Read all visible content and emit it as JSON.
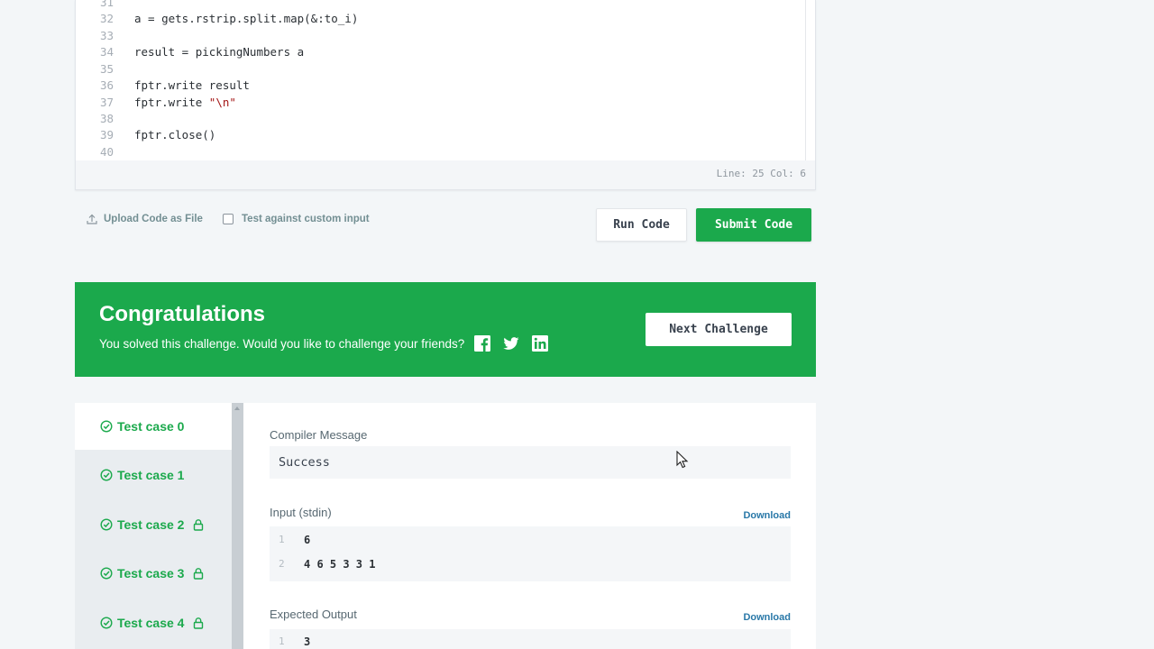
{
  "editor": {
    "lines": [
      {
        "num": "31",
        "text": ""
      },
      {
        "num": "32",
        "text": "a = gets.rstrip.split.map(&:to_i)"
      },
      {
        "num": "33",
        "text": ""
      },
      {
        "num": "34",
        "text": "result = pickingNumbers a"
      },
      {
        "num": "35",
        "text": ""
      },
      {
        "num": "36",
        "text": "fptr.write result"
      },
      {
        "num": "37",
        "text": "fptr.write ",
        "str": "\"\\n\""
      },
      {
        "num": "38",
        "text": ""
      },
      {
        "num": "39",
        "text": "fptr.close()"
      },
      {
        "num": "40",
        "text": ""
      }
    ],
    "status": "Line: 25 Col: 6"
  },
  "actions": {
    "upload_label": "Upload Code as File",
    "custom_input_label": "Test against custom input",
    "run_label": "Run Code",
    "submit_label": "Submit Code"
  },
  "congrats": {
    "title": "Congratulations",
    "message": "You solved this challenge. Would you like to challenge your friends?",
    "next_label": "Next Challenge"
  },
  "tabs": [
    {
      "label": "Test case 0",
      "locked": false,
      "active": true
    },
    {
      "label": "Test case 1",
      "locked": false,
      "active": false
    },
    {
      "label": "Test case 2",
      "locked": true,
      "active": false
    },
    {
      "label": "Test case 3",
      "locked": true,
      "active": false
    },
    {
      "label": "Test case 4",
      "locked": true,
      "active": false
    }
  ],
  "result": {
    "compiler_label": "Compiler Message",
    "compiler_message": "Success",
    "input_label": "Input (stdin)",
    "input_download": "Download",
    "input_lines": [
      {
        "num": "1",
        "text": "6"
      },
      {
        "num": "2",
        "text": "4 6 5 3 3 1"
      }
    ],
    "expected_label": "Expected Output",
    "expected_download": "Download",
    "expected_lines": [
      {
        "num": "1",
        "text": "3"
      }
    ]
  },
  "colors": {
    "accent": "#1ba94c",
    "link": "#2978a8",
    "background": "#f3f6f8"
  }
}
